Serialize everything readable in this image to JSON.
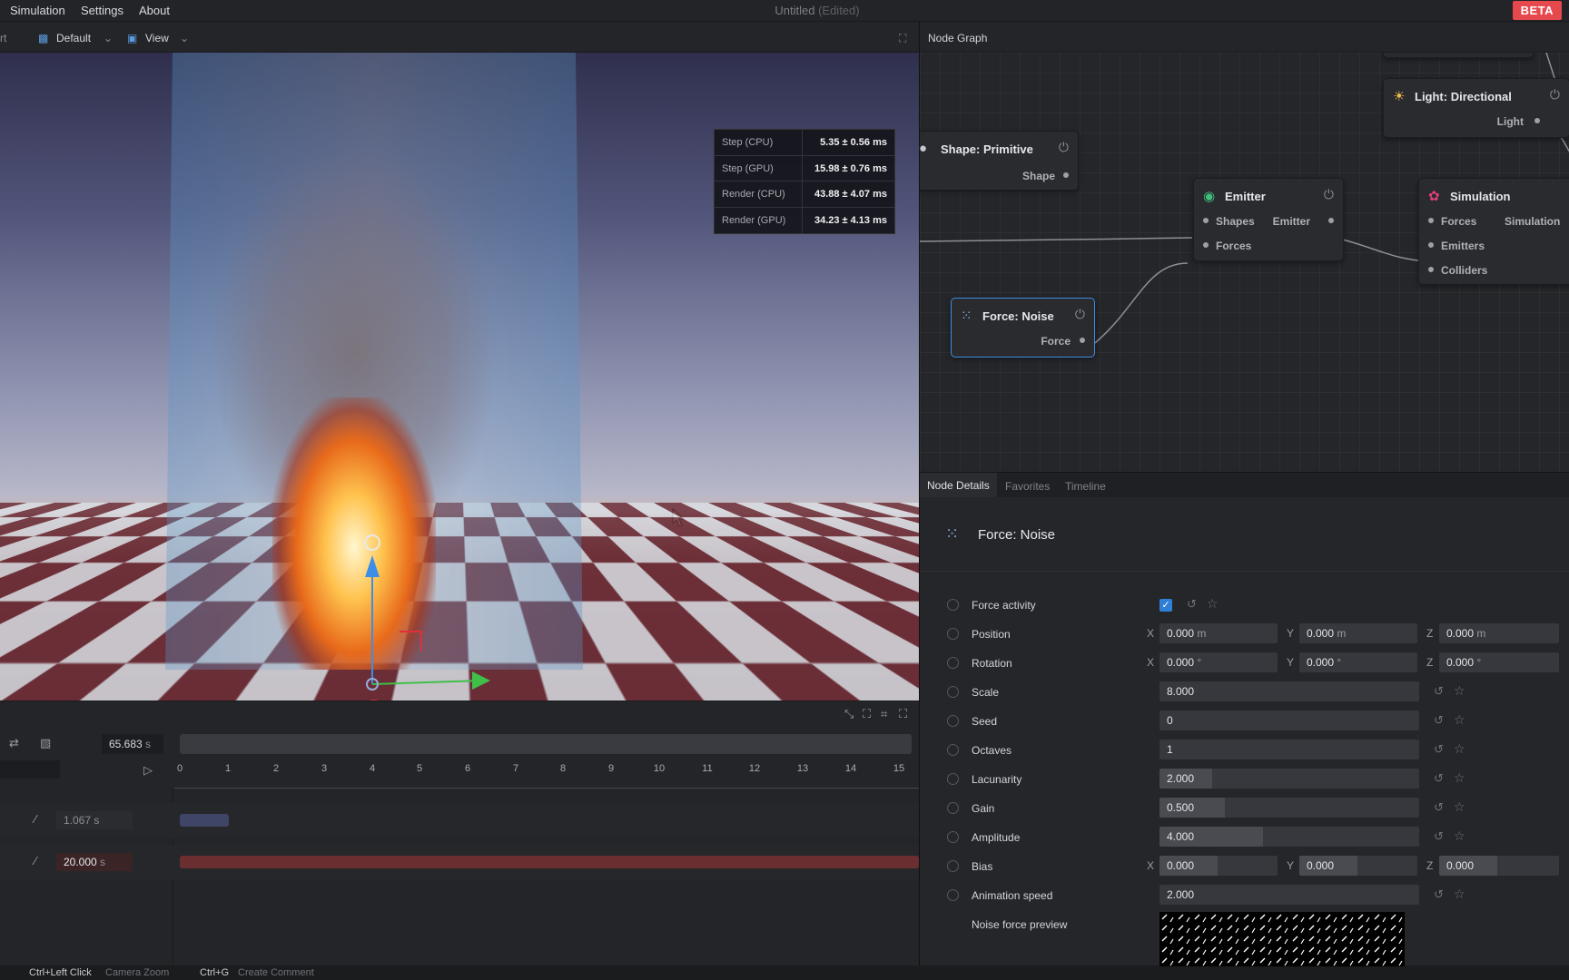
{
  "menu": {
    "items": [
      "Simulation",
      "Settings",
      "About"
    ],
    "title": "Untitled",
    "title_suffix": "(Edited)",
    "beta": "BETA"
  },
  "viewport_toolbar": {
    "left_fragment": "rt",
    "layout": "Default",
    "view": "View"
  },
  "stats": [
    {
      "label": "Step (CPU)",
      "value": "5.35 ± 0.56 ms"
    },
    {
      "label": "Step (GPU)",
      "value": "15.98 ± 0.76 ms"
    },
    {
      "label": "Render (CPU)",
      "value": "43.88 ± 4.07 ms"
    },
    {
      "label": "Render (GPU)",
      "value": "34.23 ± 4.13 ms"
    }
  ],
  "timeline": {
    "current_time": "65.683",
    "unit": "s",
    "ruler": [
      "0",
      "1",
      "2",
      "3",
      "4",
      "5",
      "6",
      "7",
      "8",
      "9",
      "10",
      "11",
      "12",
      "13",
      "14",
      "15"
    ],
    "tracks": [
      {
        "time": "1.067",
        "unit": "s"
      },
      {
        "time": "20.000",
        "unit": "s"
      }
    ]
  },
  "status_bar": [
    {
      "key": "Ctrl+Left Click",
      "desc": "Camera Zoom"
    },
    {
      "key": "Ctrl+G",
      "desc": "Create Comment"
    }
  ],
  "node_graph": {
    "title": "Node Graph",
    "nodes": {
      "light": {
        "title": "Light: Directional",
        "out": "Light"
      },
      "shape": {
        "title": "Shape: Primitive",
        "out": "Shape"
      },
      "emitter": {
        "title": "Emitter",
        "in1": "Shapes",
        "in2": "Forces",
        "out": "Emitter"
      },
      "simulation": {
        "title": "Simulation",
        "in1": "Forces",
        "in2": "Emitters",
        "in3": "Colliders",
        "out": "Simulation"
      },
      "force": {
        "title": "Force: Noise",
        "out": "Force"
      }
    }
  },
  "details": {
    "tabs": [
      "Node Details",
      "Favorites",
      "Timeline"
    ],
    "title": "Force: Noise",
    "props": {
      "force_activity": "Force activity",
      "position": {
        "label": "Position",
        "x": "0.000",
        "y": "0.000",
        "z": "0.000",
        "unit": "m"
      },
      "rotation": {
        "label": "Rotation",
        "x": "0.000",
        "y": "0.000",
        "z": "0.000",
        "unit": "°"
      },
      "scale": {
        "label": "Scale",
        "value": "8.000"
      },
      "seed": {
        "label": "Seed",
        "value": "0"
      },
      "octaves": {
        "label": "Octaves",
        "value": "1"
      },
      "lacunarity": {
        "label": "Lacunarity",
        "value": "2.000"
      },
      "gain": {
        "label": "Gain",
        "value": "0.500"
      },
      "amplitude": {
        "label": "Amplitude",
        "value": "4.000"
      },
      "bias": {
        "label": "Bias",
        "x": "0.000",
        "y": "0.000",
        "z": "0.000"
      },
      "animation_speed": {
        "label": "Animation speed",
        "value": "2.000"
      },
      "noise_preview": "Noise force preview"
    },
    "axis_labels": {
      "x": "X",
      "y": "Y",
      "z": "Z"
    }
  }
}
